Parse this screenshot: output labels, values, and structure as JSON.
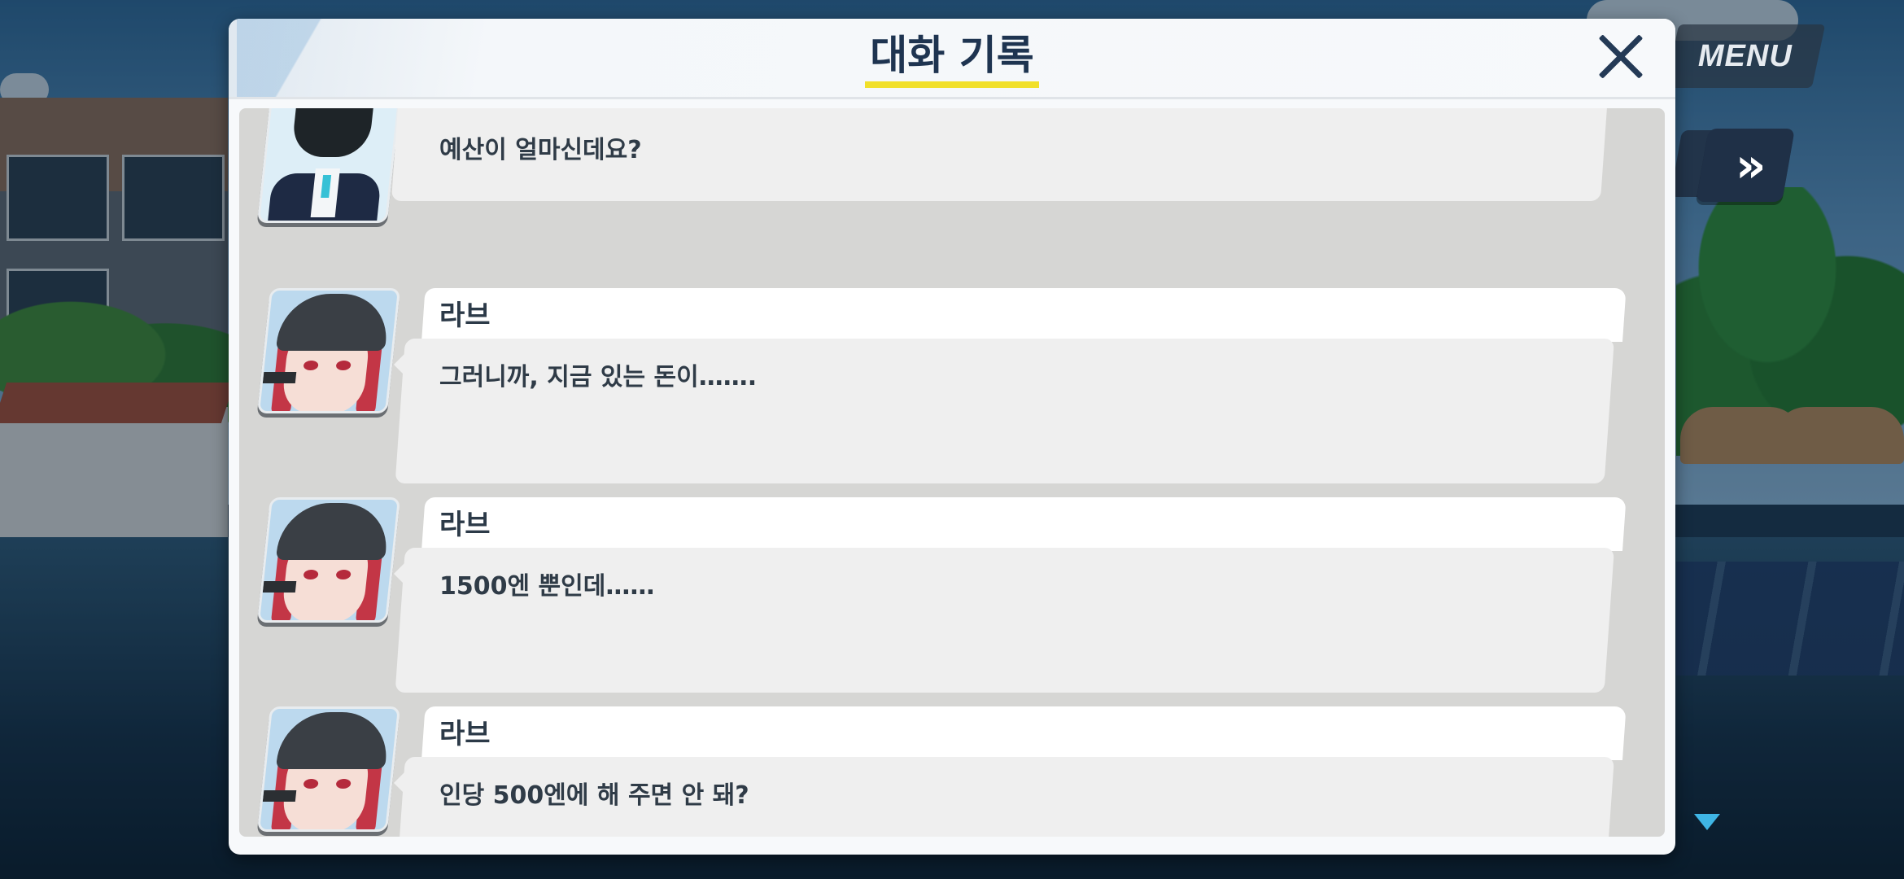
{
  "top_bar": {
    "menu_label": "MENU",
    "skip_label": "»"
  },
  "dialog": {
    "title": "대화 기록",
    "entries": [
      {
        "speaker": "",
        "text": "예산이 얼마신데요?",
        "avatar": "sensei-robot-portrait"
      },
      {
        "speaker": "라브",
        "text": "그러니까, 지금 있는 돈이…….",
        "avatar": "rabu-portrait"
      },
      {
        "speaker": "라브",
        "text": "1500엔 뿐인데……",
        "avatar": "rabu-portrait"
      },
      {
        "speaker": "라브",
        "text": "인당 500엔에 해 주면 안 돼?",
        "avatar": "rabu-portrait"
      }
    ]
  },
  "colors": {
    "title_underline": "#f1e02a",
    "title_text": "#1e3450",
    "card_name_bg": "#ffffff",
    "card_body_bg": "#efefef",
    "log_bg": "#d6d6d4",
    "more_indicator": "#3fb6e6"
  },
  "icons": {
    "close": "close-icon",
    "skip": "fast-forward-icon",
    "more": "triangle-down-icon"
  }
}
